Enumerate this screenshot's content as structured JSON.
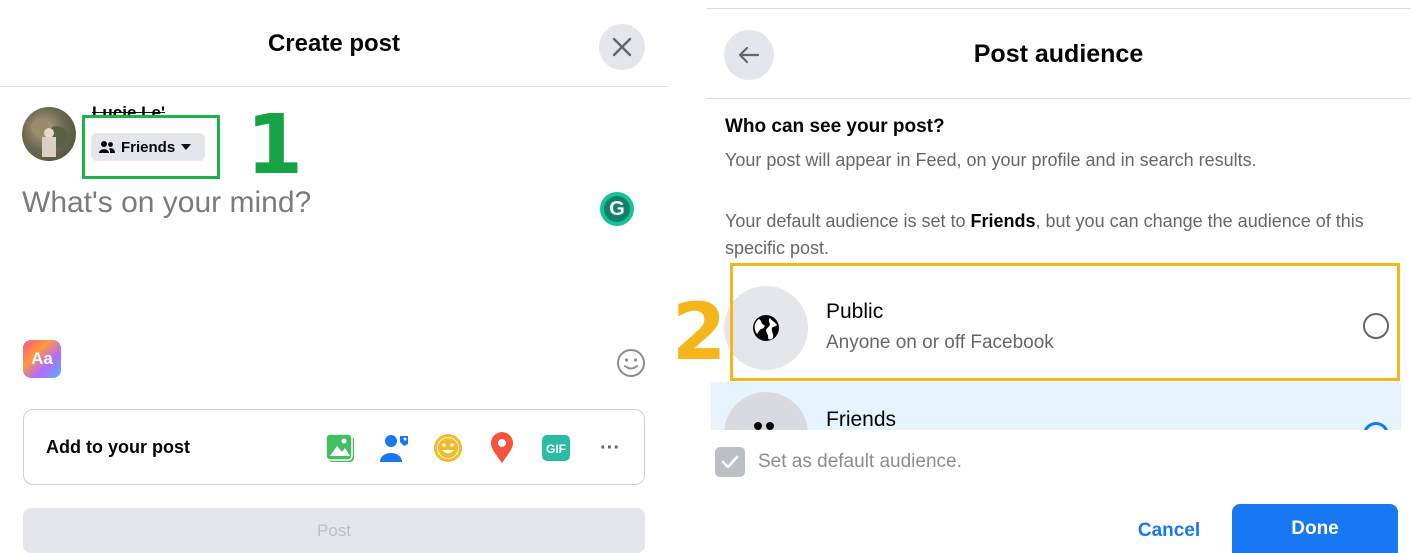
{
  "create_post": {
    "title": "Create post",
    "user_name": "Lucie Le'",
    "audience_label": "Friends",
    "annotation_number": "1",
    "composer_placeholder": "What's on your mind?",
    "grammarly_letter": "G",
    "text_style_label": "Aa",
    "add_to_post_label": "Add to your post",
    "add_icons": [
      "photo-video-icon",
      "tag-people-icon",
      "feeling-icon",
      "check-in-icon",
      "gif-icon",
      "more-icon"
    ],
    "gif_label": "GIF",
    "more_label": "···",
    "post_button_label": "Post"
  },
  "post_audience": {
    "title": "Post audience",
    "heading": "Who can see your post?",
    "subtext": "Your post will appear in Feed, on your profile and in search results.",
    "default_prefix": "Your default audience is set to ",
    "default_bold": "Friends",
    "default_suffix": ", but you can change the audience of this specific post.",
    "annotation_number": "2",
    "options": [
      {
        "title": "Public",
        "subtitle": "Anyone on or off Facebook",
        "selected": false,
        "icon": "globe-icon"
      },
      {
        "title": "Friends",
        "subtitle": "",
        "selected": true,
        "icon": "friends-icon"
      }
    ],
    "set_default_label": "Set as default audience.",
    "cancel_label": "Cancel",
    "done_label": "Done"
  },
  "colors": {
    "accent": "#1877f2",
    "annotation_green": "#1bb34b",
    "annotation_yellow": "#f5b51b",
    "selected_row": "#e7f3ff"
  }
}
